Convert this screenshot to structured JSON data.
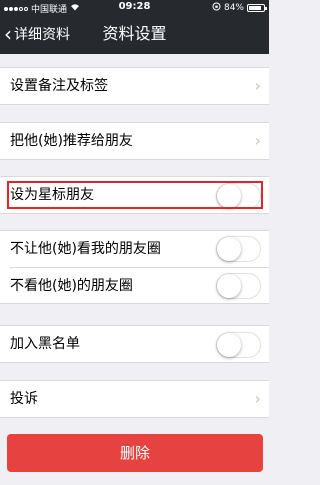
{
  "status_bar": {
    "carrier": "中国联通",
    "time": "09:28",
    "battery_text": "84%",
    "battery_level": 0.84
  },
  "nav": {
    "back_label": "详细资料",
    "title": "资料设置"
  },
  "rows": {
    "remark": "设置备注及标签",
    "recommend": "把他(她)推荐给朋友",
    "star": "设为星标朋友",
    "hide_moments": "不让他(她)看我的朋友圈",
    "not_view_moments": "不看他(她)的朋友圈",
    "blacklist": "加入黑名单",
    "report": "投诉"
  },
  "toggles": {
    "star": false,
    "hide_moments": false,
    "not_view_moments": false,
    "blacklist": false
  },
  "delete_label": "删除",
  "colors": {
    "navbar": "#262a2f",
    "delete": "#e64340",
    "highlight": "#e0262a"
  }
}
